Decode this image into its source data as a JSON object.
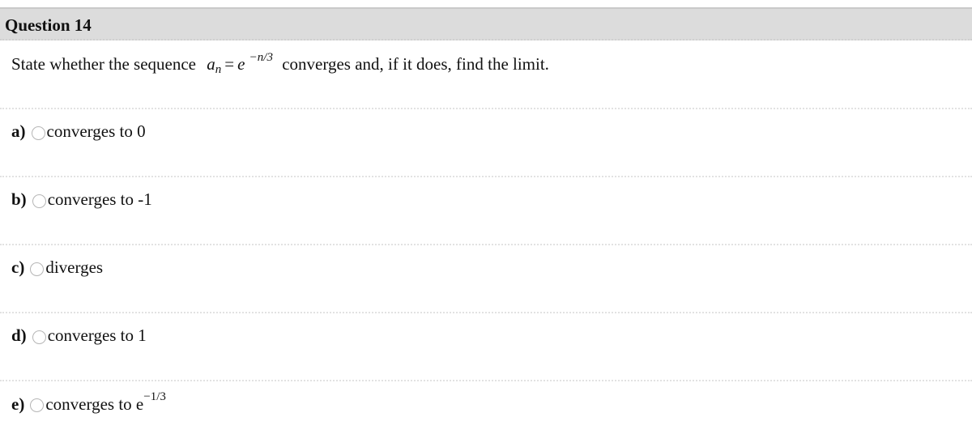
{
  "header": {
    "title": "Question 14"
  },
  "question": {
    "prefix": "State whether the sequence",
    "math_var": "a",
    "math_sub": "n",
    "math_eq": "=",
    "math_base": "e",
    "math_exp": "−n/3",
    "suffix": "converges and, if it does, find the limit."
  },
  "options": [
    {
      "letter": "a)",
      "text": "converges to 0",
      "sup": "",
      "selected": false
    },
    {
      "letter": "b)",
      "text": "converges to -1",
      "sup": "",
      "selected": false
    },
    {
      "letter": "c)",
      "text": "diverges",
      "sup": "",
      "selected": false
    },
    {
      "letter": "d)",
      "text": "converges to 1",
      "sup": "",
      "selected": false
    },
    {
      "letter": "e)",
      "text": "converges to e",
      "sup": "−1/3",
      "selected": false
    }
  ]
}
